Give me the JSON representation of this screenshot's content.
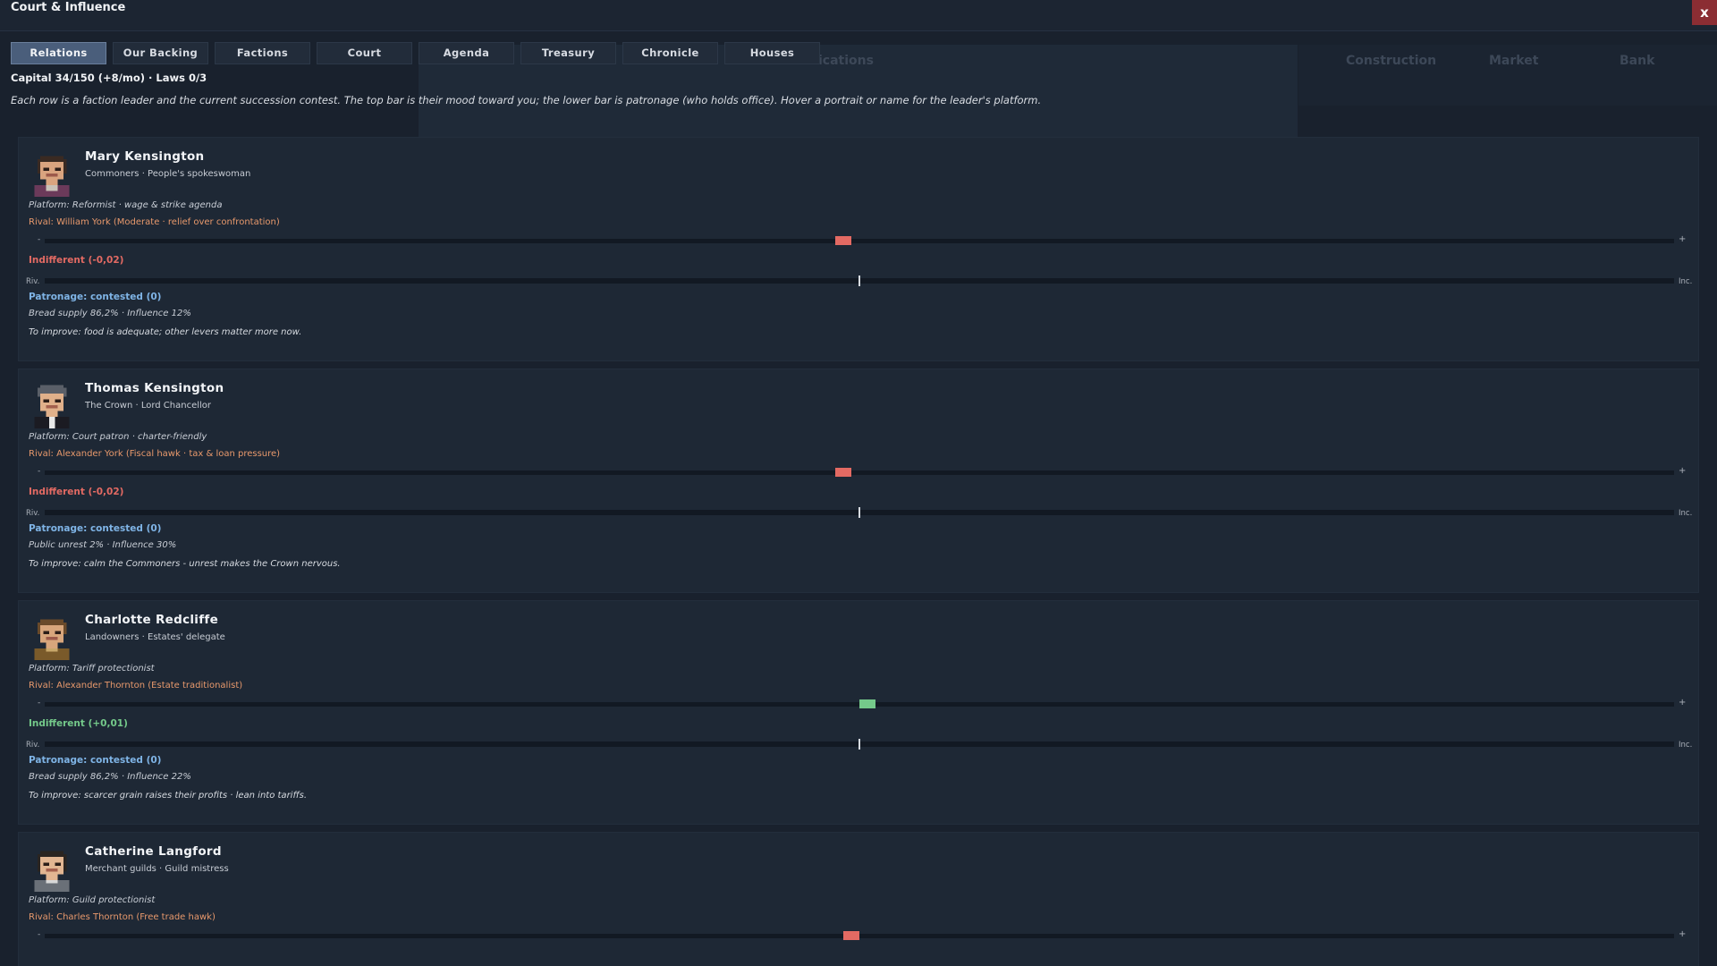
{
  "window": {
    "title": "Court & Influence",
    "close_label": "x"
  },
  "background_ui": {
    "tab_fragment": "ications",
    "right_tabs": [
      "Construction",
      "Market",
      "Bank"
    ]
  },
  "tabs": [
    {
      "label": "Relations",
      "active": true
    },
    {
      "label": "Our Backing",
      "active": false
    },
    {
      "label": "Factions",
      "active": false
    },
    {
      "label": "Court",
      "active": false
    },
    {
      "label": "Agenda",
      "active": false
    },
    {
      "label": "Treasury",
      "active": false
    },
    {
      "label": "Chronicle",
      "active": false
    },
    {
      "label": "Houses",
      "active": false
    }
  ],
  "status": {
    "capital_line": "Capital 34/150 (+8/mo) · Laws 0/3"
  },
  "intro": "Each row is a faction leader and the current succession contest. The top bar is their mood toward you; the lower bar is patronage (who holds office). Hover a portrait or name for the leader's platform.",
  "bar_labels": {
    "minus": "-",
    "plus": "+",
    "rival": "Riv.",
    "incumbent": "Inc."
  },
  "colors": {
    "negative": "#e36a63",
    "positive": "#74c98a",
    "patronage": "#7fb4e6",
    "rival_text": "#e8996c",
    "active_tab": "#4a5e7b",
    "close": "#8b2d33"
  },
  "leaders": [
    {
      "name": "Mary Kensington",
      "role": "Commoners · People's spokeswoman",
      "platform": "Platform: Reformist · wage & strike agenda",
      "rival": "Rival: William York (Moderate · relief over confrontation)",
      "mood_value": -0.02,
      "mood_label": "Indifferent (-0,02)",
      "patronage_value": 0,
      "patronage_label": "Patronage: contested (0)",
      "stats": "Bread supply 86,2% · Influence 12%",
      "improve": "To improve: food is adequate; other levers matter more now.",
      "portrait_icon": "commoner-woman-portrait"
    },
    {
      "name": "Thomas Kensington",
      "role": "The Crown · Lord Chancellor",
      "platform": "Platform: Court patron · charter-friendly",
      "rival": "Rival: Alexander York (Fiscal hawk · tax & loan pressure)",
      "mood_value": -0.02,
      "mood_label": "Indifferent (-0,02)",
      "patronage_value": 0,
      "patronage_label": "Patronage: contested (0)",
      "stats": "Public unrest 2% · Influence 30%",
      "improve": "To improve: calm the Commoners - unrest makes the Crown nervous.",
      "portrait_icon": "chancellor-portrait"
    },
    {
      "name": "Charlotte Redcliffe",
      "role": "Landowners · Estates' delegate",
      "platform": "Platform: Tariff protectionist",
      "rival": "Rival: Alexander Thornton (Estate traditionalist)",
      "mood_value": 0.01,
      "mood_label": "Indifferent (+0,01)",
      "patronage_value": 0,
      "patronage_label": "Patronage: contested (0)",
      "stats": "Bread supply 86,2% · Influence 22%",
      "improve": "To improve: scarcer grain raises their profits · lean into tariffs.",
      "portrait_icon": "landowner-portrait"
    },
    {
      "name": "Catherine Langford",
      "role": "Merchant guilds · Guild mistress",
      "platform": "Platform: Guild protectionist",
      "rival": "Rival: Charles Thornton (Free trade hawk)",
      "mood_value": -0.01,
      "mood_label": "",
      "patronage_value": 0,
      "patronage_label": "",
      "stats": "",
      "improve": "",
      "portrait_icon": "merchant-woman-portrait"
    }
  ]
}
